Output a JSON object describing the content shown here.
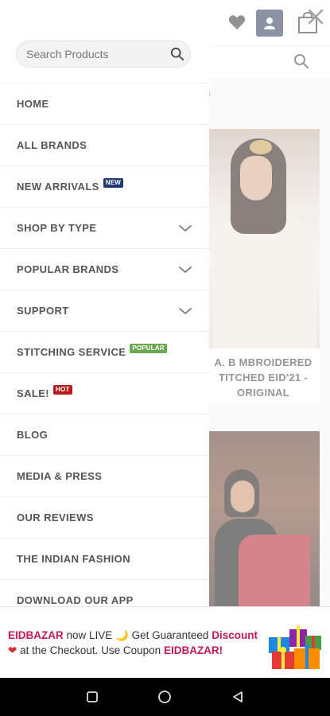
{
  "header": {
    "icons": [
      "heart-icon",
      "user-icon",
      "shopping-bag-icon",
      "close-icon",
      "search-icon"
    ],
    "accent_color": "#2a3a5a"
  },
  "background": {
    "edge_text": "s",
    "products": [
      {
        "title": "A. B MBROIDERED TITCHED EID'21 - ORIGINAL"
      },
      {
        "title": ""
      }
    ]
  },
  "drawer": {
    "search": {
      "placeholder": "Search Products"
    },
    "menu": [
      {
        "label": "HOME"
      },
      {
        "label": "ALL BRANDS"
      },
      {
        "label": "NEW ARRIVALS",
        "badge": "NEW",
        "badge_color": "#1e3a6e"
      },
      {
        "label": "SHOP BY TYPE",
        "expandable": true
      },
      {
        "label": "POPULAR BRANDS",
        "expandable": true
      },
      {
        "label": "SUPPORT",
        "expandable": true
      },
      {
        "label": "STITCHING SERVICE",
        "badge": "POPULAR",
        "badge_color": "#6aa84f"
      },
      {
        "label": "SALE!",
        "badge": "HOT",
        "badge_color": "#b71c1c"
      },
      {
        "label": "BLOG"
      },
      {
        "label": "MEDIA & PRESS"
      },
      {
        "label": "OUR REVIEWS"
      },
      {
        "label": "THE INDIAN FASHION"
      },
      {
        "label": "DOWNLOAD OUR APP"
      }
    ]
  },
  "promo": {
    "brand": "EIDBAZAR",
    "part1": " now LIVE ",
    "moon": "🌙",
    "part2": " Get Guaranteed ",
    "discount": "Discount",
    "heart": "❤",
    "part3": " at the Checkout. Use Coupon ",
    "coupon": "EIDBAZAR!",
    "highlight_color": "#c2185b",
    "icon": "gift-boxes-icon"
  },
  "navbar": {
    "icons": [
      "recent-apps-icon",
      "home-icon",
      "back-icon"
    ]
  }
}
